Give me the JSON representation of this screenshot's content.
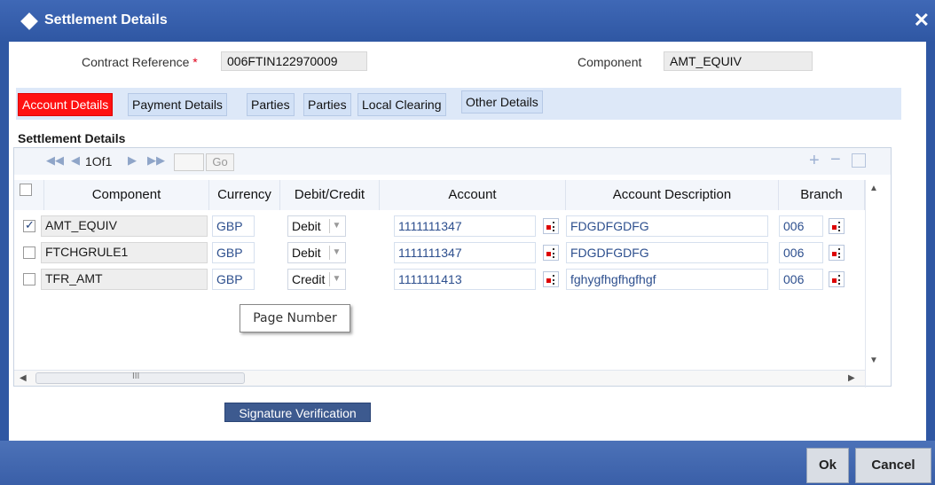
{
  "window": {
    "title": "Settlement Details",
    "close_glyph": "✕"
  },
  "header": {
    "contract_reference_label": "Contract Reference",
    "required_marker": "*",
    "contract_reference_value": "006FTIN122970009",
    "component_label": "Component",
    "component_value": "AMT_EQUIV"
  },
  "tabs": [
    "Account Details",
    "Payment Details",
    "Parties",
    "Parties",
    "Local Clearing",
    "Other Details"
  ],
  "active_tab": 0,
  "section_title": "Settlement Details",
  "pager": {
    "first": "◀◀",
    "prev": "◀",
    "page_text": "1Of1",
    "next": "▶",
    "last": "▶▶",
    "go_label": "Go"
  },
  "grid_actions": {
    "add": "+",
    "remove": "−"
  },
  "columns": [
    "Component",
    "Currency",
    "Debit/Credit",
    "Account",
    "Account Description",
    "Branch"
  ],
  "rows": [
    {
      "checked": true,
      "component": "AMT_EQUIV",
      "currency": "GBP",
      "debit_credit": "Debit",
      "account": "1111111347",
      "description": "FDGDFGDFG",
      "branch": "006"
    },
    {
      "checked": false,
      "component": "FTCHGRULE1",
      "currency": "GBP",
      "debit_credit": "Debit",
      "account": "1111111347",
      "description": "FDGDFGDFG",
      "branch": "006"
    },
    {
      "checked": false,
      "component": "TFR_AMT",
      "currency": "GBP",
      "debit_credit": "Credit",
      "account": "1111111413",
      "description": "fghygfhgfhgfhgf",
      "branch": "006"
    }
  ],
  "scroll_thumb_label": "III",
  "tooltip": "Page Number",
  "buttons": {
    "signature": "Signature Verification",
    "ok": "Ok",
    "cancel": "Cancel"
  },
  "colors": {
    "titlebar": "#3a62ae",
    "active_tab": "#ff1111",
    "tab_strip": "#dde8f8",
    "footer": "#4c72b8"
  }
}
